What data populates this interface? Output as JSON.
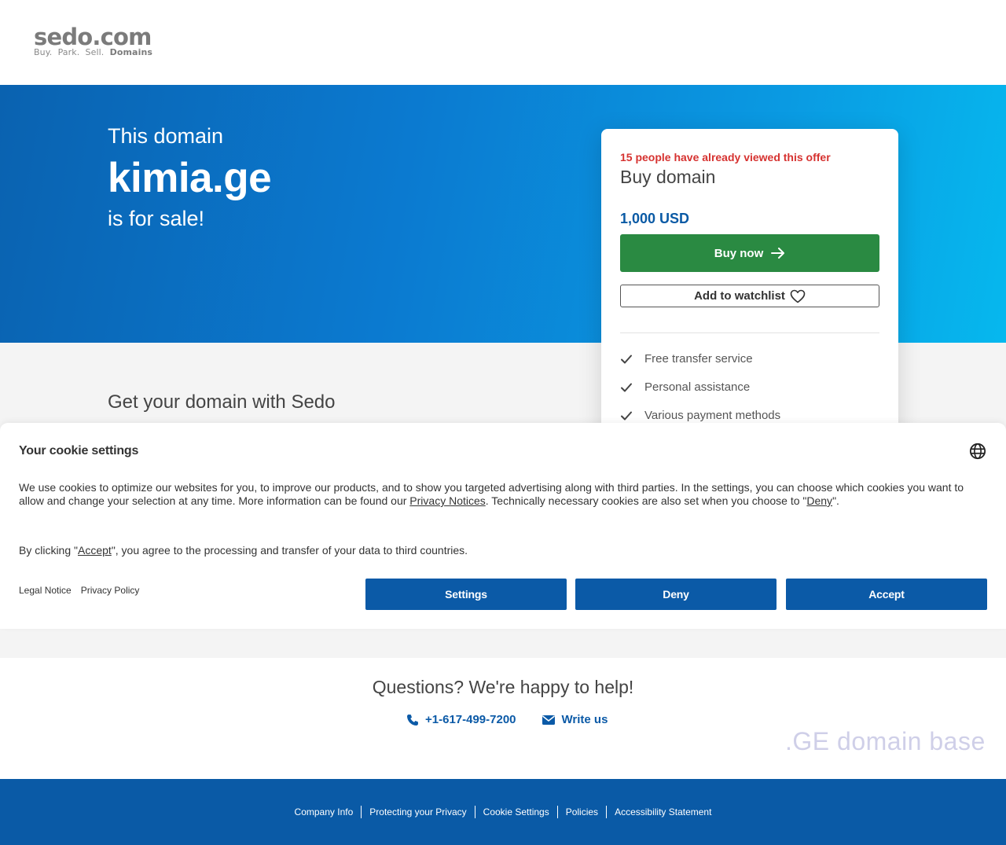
{
  "header": {
    "logo_main": "sedo.com",
    "logo_tag_parts": [
      "Buy.",
      "Park.",
      "Sell."
    ],
    "logo_tag_bold": "Domains"
  },
  "hero": {
    "pre": "This domain",
    "domain": "kimia.ge",
    "post": "is for sale!"
  },
  "offer": {
    "views_text": "15 people have already viewed this offer",
    "title": "Buy domain",
    "price": "1,000 USD",
    "buy_label": "Buy now",
    "watchlist_label": "Add to watchlist",
    "features": [
      "Free transfer service",
      "Personal assistance",
      "Various payment methods"
    ]
  },
  "section": {
    "title": "Get your domain with Sedo"
  },
  "cookie": {
    "title": "Your cookie settings",
    "text_a": "We use cookies to optimize our websites for you, to improve our products, and to show you targeted advertising along with third parties. In the settings, you can choose which cookies you want to allow and change your selection at any time. More information can be found our ",
    "privacy_link": "Privacy Notices",
    "text_b": ". Technically necessary cookies are also set when you choose to \"",
    "deny_link": "Deny",
    "text_c": "\".",
    "consent_a": "By clicking \"",
    "accept_link": "Accept",
    "consent_b": "\", you agree to the processing and transfer of your data to third countries.",
    "legal_notice": "Legal Notice",
    "privacy_policy": "Privacy Policy",
    "settings_btn": "Settings",
    "deny_btn": "Deny",
    "accept_btn": "Accept"
  },
  "help": {
    "title": "Questions? We're happy to help!",
    "phone": "+1-617-499-7200",
    "write": "Write us",
    "watermark": ".GE domain base"
  },
  "footer": {
    "links": [
      "Company Info",
      "Protecting your Privacy",
      "Cookie Settings",
      "Policies",
      "Accessibility Statement"
    ]
  },
  "colors": {
    "brand_blue": "#0b5aa7",
    "buy_green": "#2a8a42",
    "alert_red": "#d63230"
  }
}
